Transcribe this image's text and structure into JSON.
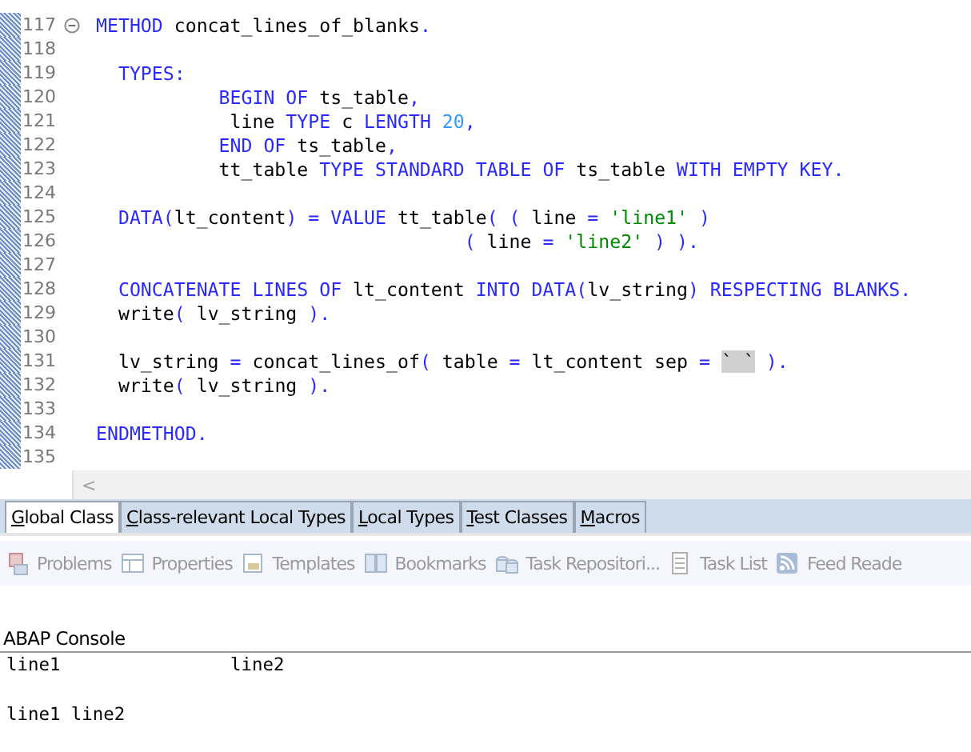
{
  "editor": {
    "lines": [
      {
        "number": "117",
        "folding": true,
        "tokens": [
          {
            "kind": "kw",
            "text": "METHOD"
          },
          {
            "kind": "id",
            "text": " concat_lines_of_blanks"
          },
          {
            "kind": "kw",
            "text": "."
          }
        ]
      },
      {
        "number": "118"
      },
      {
        "number": "119",
        "tokens": [
          {
            "kind": "kw",
            "text": "  TYPES:"
          }
        ]
      },
      {
        "number": "120",
        "tokens": [
          {
            "kind": "kw",
            "text": "           BEGIN OF"
          },
          {
            "kind": "id",
            "text": " ts_table"
          },
          {
            "kind": "kw",
            "text": ","
          }
        ]
      },
      {
        "number": "121",
        "tokens": [
          {
            "kind": "id",
            "text": "            line"
          },
          {
            "kind": "kw",
            "text": " TYPE"
          },
          {
            "kind": "id",
            "text": " c"
          },
          {
            "kind": "kw",
            "text": " LENGTH"
          },
          {
            "kind": "num",
            "text": " 20"
          },
          {
            "kind": "kw",
            "text": ","
          }
        ]
      },
      {
        "number": "122",
        "tokens": [
          {
            "kind": "kw",
            "text": "           END OF"
          },
          {
            "kind": "id",
            "text": " ts_table"
          },
          {
            "kind": "kw",
            "text": ","
          }
        ]
      },
      {
        "number": "123",
        "tokens": [
          {
            "kind": "id",
            "text": "           tt_table"
          },
          {
            "kind": "kw",
            "text": " TYPE STANDARD TABLE OF"
          },
          {
            "kind": "id",
            "text": " ts_table"
          },
          {
            "kind": "kw",
            "text": " WITH EMPTY KEY."
          }
        ]
      },
      {
        "number": "124"
      },
      {
        "number": "125",
        "tokens": [
          {
            "kind": "kw",
            "text": "  DATA("
          },
          {
            "kind": "id",
            "text": "lt_content"
          },
          {
            "kind": "kw",
            "text": ") = VALUE"
          },
          {
            "kind": "id",
            "text": " tt_table"
          },
          {
            "kind": "kw",
            "text": "( ("
          },
          {
            "kind": "id",
            "text": " line"
          },
          {
            "kind": "kw",
            "text": " ="
          },
          {
            "kind": "str",
            "text": " 'line1'"
          },
          {
            "kind": "kw",
            "text": " )"
          }
        ]
      },
      {
        "number": "126",
        "tokens": [
          {
            "kind": "kw",
            "text": "                                 ("
          },
          {
            "kind": "id",
            "text": " line"
          },
          {
            "kind": "kw",
            "text": " ="
          },
          {
            "kind": "str",
            "text": " 'line2'"
          },
          {
            "kind": "kw",
            "text": " ) )."
          }
        ]
      },
      {
        "number": "127"
      },
      {
        "number": "128",
        "tokens": [
          {
            "kind": "kw",
            "text": "  CONCATENATE LINES OF"
          },
          {
            "kind": "id",
            "text": " lt_content"
          },
          {
            "kind": "kw",
            "text": " INTO DATA("
          },
          {
            "kind": "id",
            "text": "lv_string"
          },
          {
            "kind": "kw",
            "text": ") RESPECTING BLANKS."
          }
        ]
      },
      {
        "number": "129",
        "tokens": [
          {
            "kind": "id",
            "text": "  write"
          },
          {
            "kind": "kw",
            "text": "("
          },
          {
            "kind": "id",
            "text": " lv_string"
          },
          {
            "kind": "kw",
            "text": " )."
          }
        ]
      },
      {
        "number": "130"
      },
      {
        "number": "131",
        "tokens": [
          {
            "kind": "id",
            "text": "  lv_string"
          },
          {
            "kind": "kw",
            "text": " ="
          },
          {
            "kind": "id",
            "text": " concat_lines_of"
          },
          {
            "kind": "kw",
            "text": "("
          },
          {
            "kind": "id",
            "text": " table"
          },
          {
            "kind": "kw",
            "text": " ="
          },
          {
            "kind": "id",
            "text": " lt_content sep"
          },
          {
            "kind": "kw",
            "text": " = "
          },
          {
            "kind": "sel",
            "text": "` `"
          },
          {
            "kind": "kw",
            "text": " )."
          }
        ]
      },
      {
        "number": "132",
        "tokens": [
          {
            "kind": "id",
            "text": "  write"
          },
          {
            "kind": "kw",
            "text": "("
          },
          {
            "kind": "id",
            "text": " lv_string"
          },
          {
            "kind": "kw",
            "text": " )."
          }
        ]
      },
      {
        "number": "133"
      },
      {
        "number": "134",
        "tokens": [
          {
            "kind": "kw",
            "text": "ENDMETHOD."
          }
        ]
      },
      {
        "number": "135"
      }
    ],
    "scroll_left": "<"
  },
  "class_tabs": [
    {
      "label": "Global Class",
      "selected": true
    },
    {
      "label": "Class-relevant Local Types",
      "selected": false
    },
    {
      "label": "Local Types",
      "selected": false
    },
    {
      "label": "Test Classes",
      "selected": false
    },
    {
      "label": "Macros",
      "selected": false
    }
  ],
  "views": [
    {
      "label": "Problems"
    },
    {
      "label": "Properties"
    },
    {
      "label": "Templates"
    },
    {
      "label": "Bookmarks"
    },
    {
      "label": "Task Repositori..."
    },
    {
      "label": "Task List"
    },
    {
      "label": "Feed Reade"
    }
  ],
  "console": {
    "title": "ABAP Console",
    "lines": [
      [
        "line1",
        "line2"
      ],
      [
        "line1 line2"
      ]
    ]
  }
}
